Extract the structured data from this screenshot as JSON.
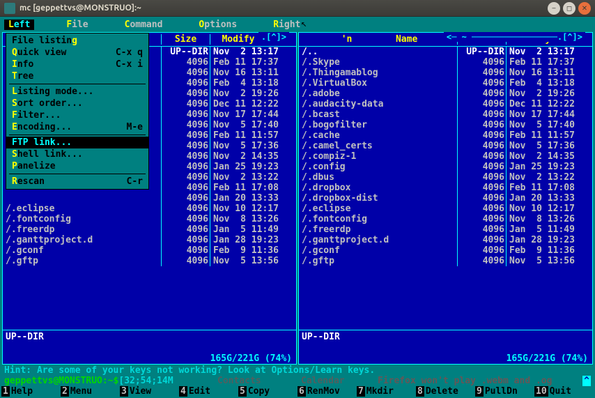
{
  "titlebar": {
    "text": "mc [geppettvs@MONSTRUO]:~"
  },
  "menubar": {
    "left": "Left",
    "file": "File",
    "command": "Command",
    "options": "Options",
    "right": "Right"
  },
  "dropdown": {
    "items": [
      {
        "label": "File listing",
        "hot": "g",
        "short": ""
      },
      {
        "label": "Quick view",
        "hot": "Q",
        "short": "C-x q"
      },
      {
        "label": "Info",
        "hot": "I",
        "short": "C-x i"
      },
      {
        "label": "Tree",
        "hot": "T",
        "short": ""
      }
    ],
    "items2": [
      {
        "label": "Listing mode...",
        "hot": "L",
        "short": ""
      },
      {
        "label": "Sort order...",
        "hot": "S",
        "short": ""
      },
      {
        "label": "Filter...",
        "hot": "F",
        "short": ""
      },
      {
        "label": "Encoding...",
        "hot": "E",
        "short": "M-e"
      }
    ],
    "items3": [
      {
        "label": "FTP link...",
        "hot": "",
        "short": "",
        "selected": true
      },
      {
        "label": "Shell link...",
        "hot": "S",
        "short": ""
      },
      {
        "label": "Panelize",
        "hot": "P",
        "short": ""
      }
    ],
    "items4": [
      {
        "label": "Rescan",
        "hot": "R",
        "short": "C-r"
      }
    ]
  },
  "panel_headers": {
    "name": "Name",
    "n": "'n",
    "size": "Size",
    "modify": "Modify time"
  },
  "left_title": ".[^]>",
  "right_title": "<─ ~ ─────────────────.[^]>",
  "left_rows_partial": [
    {
      "name": "/.eclipse",
      "size": "4096",
      "modify": "Nov 10 12:17"
    },
    {
      "name": "/.fontconfig",
      "size": "4096",
      "modify": "Nov  8 13:26"
    },
    {
      "name": "/.freerdp",
      "size": "4096",
      "modify": "Jan  5 11:49"
    },
    {
      "name": "/.ganttproject.d",
      "size": "4096",
      "modify": "Jan 28 19:23"
    },
    {
      "name": "/.gconf",
      "size": "4096",
      "modify": "Feb  9 11:36"
    },
    {
      "name": "/.gftp",
      "size": "4096",
      "modify": "Nov  5 13:56"
    }
  ],
  "left_hidden_rows": [
    {
      "size": "UP--DIR",
      "modify": "Nov  2 13:17"
    },
    {
      "size": "4096",
      "modify": "Feb 11 17:37"
    },
    {
      "size": "4096",
      "modify": "Nov 16 13:11"
    },
    {
      "size": "4096",
      "modify": "Feb  4 13:18"
    },
    {
      "size": "4096",
      "modify": "Nov  2 19:26"
    },
    {
      "size": "4096",
      "modify": "Dec 11 12:22"
    },
    {
      "size": "4096",
      "modify": "Nov 17 17:44"
    },
    {
      "size": "4096",
      "modify": "Nov  5 17:40"
    },
    {
      "size": "4096",
      "modify": "Feb 11 11:57"
    },
    {
      "size": "4096",
      "modify": "Nov  5 17:36"
    },
    {
      "size": "4096",
      "modify": "Nov  2 14:35"
    },
    {
      "size": "4096",
      "modify": "Jan 25 19:23"
    },
    {
      "size": "4096",
      "modify": "Nov  2 13:22"
    },
    {
      "size": "4096",
      "modify": "Feb 11 17:08"
    },
    {
      "size": "4096",
      "modify": "Jan 20 13:33"
    }
  ],
  "right_rows": [
    {
      "name": "/..",
      "size": "UP--DIR",
      "modify": "Nov  2 13:17",
      "updir": true
    },
    {
      "name": "/.Skype",
      "size": "4096",
      "modify": "Feb 11 17:37"
    },
    {
      "name": "/.Thingamablog",
      "size": "4096",
      "modify": "Nov 16 13:11"
    },
    {
      "name": "/.VirtualBox",
      "size": "4096",
      "modify": "Feb  4 13:18"
    },
    {
      "name": "/.adobe",
      "size": "4096",
      "modify": "Nov  2 19:26"
    },
    {
      "name": "/.audacity-data",
      "size": "4096",
      "modify": "Dec 11 12:22"
    },
    {
      "name": "/.bcast",
      "size": "4096",
      "modify": "Nov 17 17:44"
    },
    {
      "name": "/.bogofilter",
      "size": "4096",
      "modify": "Nov  5 17:40"
    },
    {
      "name": "/.cache",
      "size": "4096",
      "modify": "Feb 11 11:57"
    },
    {
      "name": "/.camel_certs",
      "size": "4096",
      "modify": "Nov  5 17:36"
    },
    {
      "name": "/.compiz-1",
      "size": "4096",
      "modify": "Nov  2 14:35"
    },
    {
      "name": "/.config",
      "size": "4096",
      "modify": "Jan 25 19:23"
    },
    {
      "name": "/.dbus",
      "size": "4096",
      "modify": "Nov  2 13:22"
    },
    {
      "name": "/.dropbox",
      "size": "4096",
      "modify": "Feb 11 17:08"
    },
    {
      "name": "/.dropbox-dist",
      "size": "4096",
      "modify": "Jan 20 13:33"
    },
    {
      "name": "/.eclipse",
      "size": "4096",
      "modify": "Nov 10 12:17"
    },
    {
      "name": "/.fontconfig",
      "size": "4096",
      "modify": "Nov  8 13:26"
    },
    {
      "name": "/.freerdp",
      "size": "4096",
      "modify": "Jan  5 11:49"
    },
    {
      "name": "/.ganttproject.d",
      "size": "4096",
      "modify": "Jan 28 19:23"
    },
    {
      "name": "/.gconf",
      "size": "4096",
      "modify": "Feb  9 11:36"
    },
    {
      "name": "/.gftp",
      "size": "4096",
      "modify": "Nov  5 13:56"
    }
  ],
  "footer": {
    "current": "UP--DIR",
    "status": "165G/221G (74%)"
  },
  "hint": "Hint: Are some of your keys not working? Look at Options/Learn keys.",
  "prompt": {
    "text": "geppettvs@MONSTRUO:~$ ",
    "extra": "[32;54;14M"
  },
  "ghost": {
    "contacts": "Contacts",
    "calendar": "Calendar",
    "firefox": "Firefox won't play .webm and .og"
  },
  "fkeys": [
    {
      "n": "1",
      "l": "Help"
    },
    {
      "n": "2",
      "l": "Menu"
    },
    {
      "n": "3",
      "l": "View"
    },
    {
      "n": "4",
      "l": "Edit"
    },
    {
      "n": "5",
      "l": "Copy"
    },
    {
      "n": "6",
      "l": "RenMov"
    },
    {
      "n": "7",
      "l": "Mkdir"
    },
    {
      "n": "8",
      "l": "Delete"
    },
    {
      "n": "9",
      "l": "PullDn"
    },
    {
      "n": "10",
      "l": "Quit"
    }
  ]
}
